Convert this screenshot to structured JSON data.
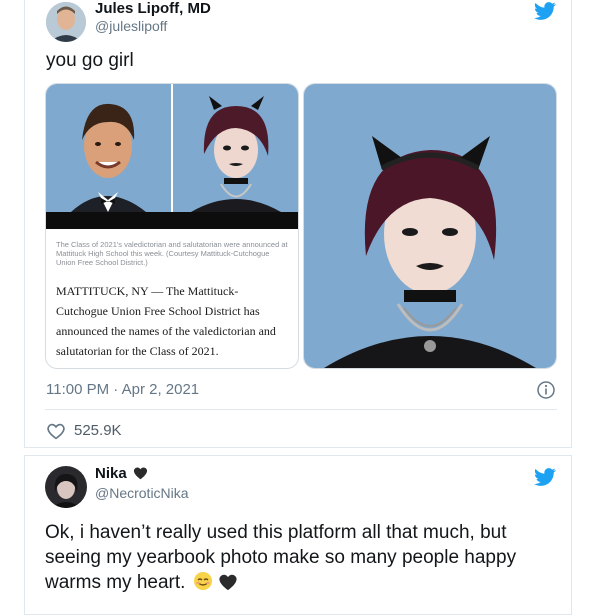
{
  "tweet1": {
    "author_name": "Jules Lipoff, MD",
    "author_handle": "@juleslipoff",
    "text": "you go girl",
    "article_caption": "The Class of 2021's valedictorian and salutatorian were announced at Mattituck High School this week. (Courtesy Mattituck-Cutchogue Union Free School District.)",
    "article_body": "MATTITUCK, NY — The Mattituck-Cutchogue Union Free School District has announced the names of the valedictorian and salutatorian for the Class of 2021.",
    "timestamp": "11:00 PM · Apr 2, 2021",
    "like_count": "525.9K"
  },
  "tweet2": {
    "author_name": "Nika",
    "author_handle": "@NecroticNika",
    "text": "Ok, i haven’t really used this platform all that much, but seeing my yearbook photo make so many people happy warms my heart."
  },
  "colors": {
    "twitter_blue": "#1da1f2",
    "muted_text": "#657786",
    "border": "#e1e8ed",
    "photo_background": "#7fa9cf"
  }
}
